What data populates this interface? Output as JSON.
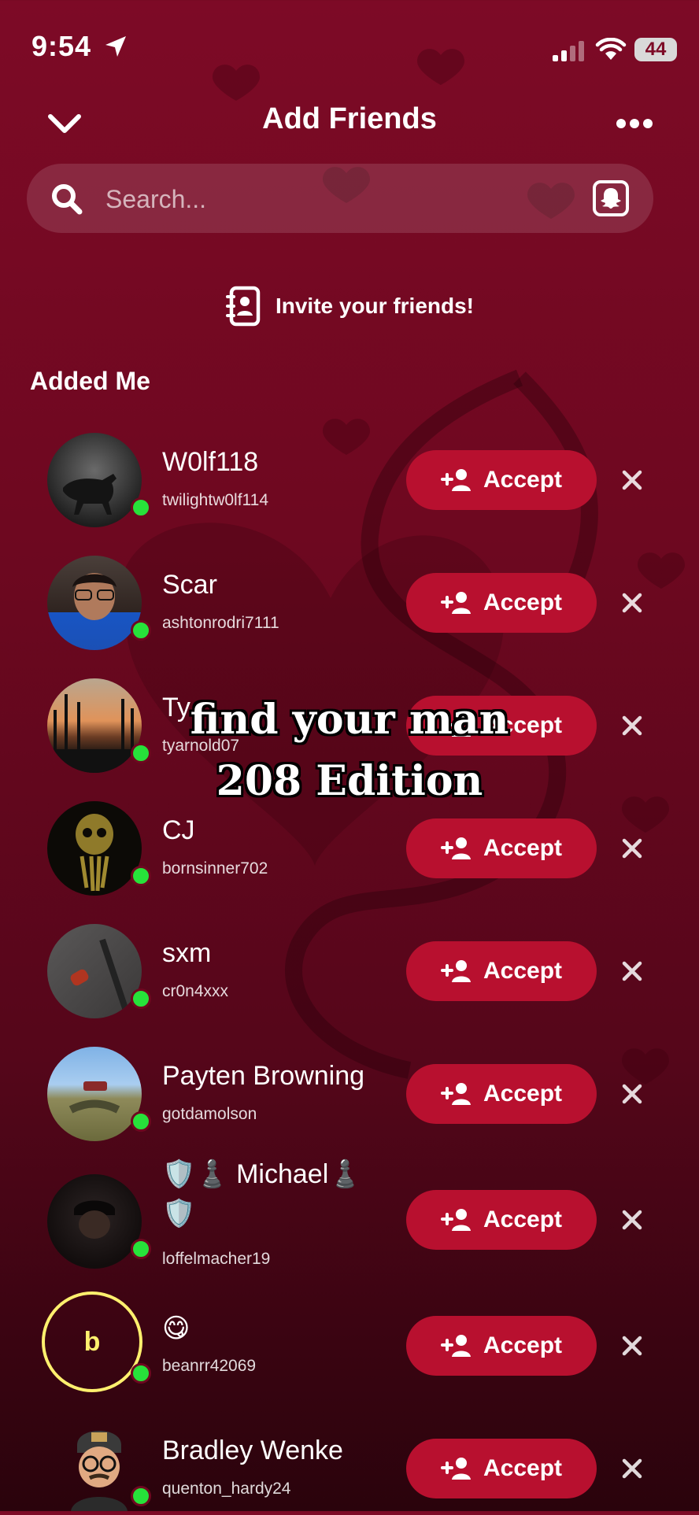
{
  "status_bar": {
    "time": "9:54",
    "battery": "44"
  },
  "header": {
    "title": "Add Friends"
  },
  "search": {
    "placeholder": "Search..."
  },
  "invite": {
    "label": "Invite your friends!"
  },
  "section": {
    "title": "Added Me"
  },
  "accept_label": "Accept",
  "requests": [
    {
      "display_name": "W0lf118",
      "username": "twilightw0lf114"
    },
    {
      "display_name": "Scar",
      "username": "ashtonrodri7111"
    },
    {
      "display_name": "Ty",
      "username": "tyarnold07"
    },
    {
      "display_name": "CJ",
      "username": "bornsinner702"
    },
    {
      "display_name": "sxm",
      "username": "cr0n4xxx"
    },
    {
      "display_name": "Payten Browning",
      "username": "gotdamolson"
    },
    {
      "display_name": "🛡️♟️ Michael♟️",
      "display_name_line2": "🛡️",
      "username": "loffelmacher19"
    },
    {
      "display_name": "😋",
      "username": "beanrr42069",
      "avatar_letter": "b"
    },
    {
      "display_name": "Bradley Wenke",
      "username": "quenton_hardy24"
    }
  ],
  "overlay": {
    "line1": "find your man",
    "line2": "208 Edition"
  },
  "colors": {
    "accent": "#b8102f",
    "online": "#27e23a",
    "background": "#6e0820"
  }
}
